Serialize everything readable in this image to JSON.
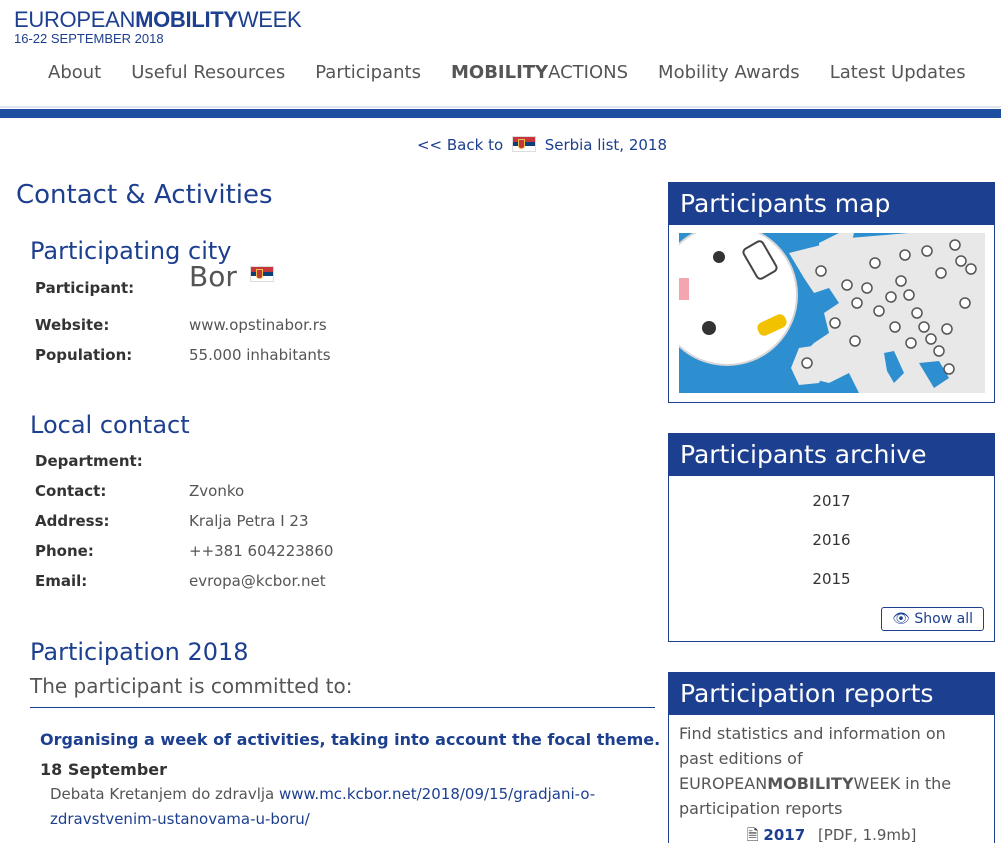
{
  "header": {
    "logo_part1": "EUROPEAN",
    "logo_part2": "MOBILITY",
    "logo_part3": "WEEK",
    "logo_dates": "16-22 SEPTEMBER 2018"
  },
  "nav": {
    "about": "About",
    "resources": "Useful Resources",
    "participants": "Participants",
    "actions_bold": "MOBILITY",
    "actions_rest": "ACTIONS",
    "awards": "Mobility Awards",
    "updates": "Latest Updates"
  },
  "backlink": {
    "prefix": "<< Back to",
    "country": "Serbia list, 2018"
  },
  "page_title": "Contact & Activities",
  "city": {
    "heading": "Participating city",
    "participant_label": "Participant:",
    "participant_value": "Bor",
    "website_label": "Website:",
    "website_value": "www.opstinabor.rs",
    "population_label": "Population:",
    "population_value": "55.000 inhabitants"
  },
  "contact": {
    "heading": "Local contact",
    "department_label": "Department:",
    "contact_label": "Contact:",
    "contact_value": "Zvonko",
    "address_label": "Address:",
    "address_value": "Kralja Petra I 23",
    "phone_label": "Phone:",
    "phone_value": "++381 604223860",
    "email_label": "Email:",
    "email_value": "evropa@kcbor.net"
  },
  "participation": {
    "heading": "Participation 2018",
    "committed": "The participant is committed to:",
    "activity_title": "Organising a week of activities, taking into account the focal theme.",
    "date": "18 September",
    "desc_text": "Debata Kretanjem do zdravlja",
    "desc_link": "www.mc.kcbor.net/2018/09/15/gradjani-o-zdravstvenim-ustanovama-u-boru/"
  },
  "sidebar": {
    "map_title": "Participants map",
    "archive_title": "Participants archive",
    "archive_years": [
      "2017",
      "2016",
      "2015"
    ],
    "show_all": "Show all",
    "reports_title": "Participation reports",
    "reports_text1": "Find statistics and information on past editions of EUROPEAN",
    "reports_text_bold": "MOBILITY",
    "reports_text2": "WEEK in the participation reports",
    "pdf_year": "2017",
    "pdf_meta": "[PDF, 1.9mb]"
  },
  "colors": {
    "brand_blue": "#1d3f8f",
    "bar_blue": "#1d4ea0",
    "map_sea": "#2e8fd0",
    "map_land": "#e8e8e8"
  }
}
